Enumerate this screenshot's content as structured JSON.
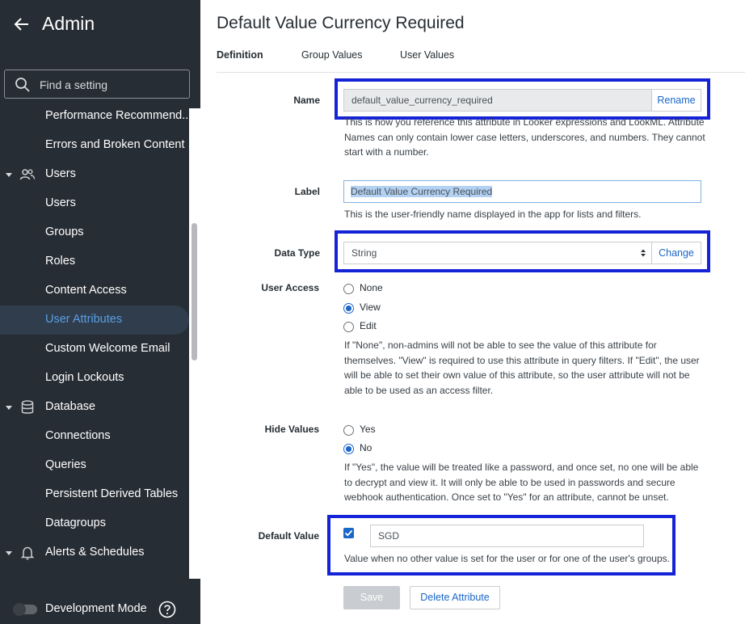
{
  "sidebar": {
    "title": "Admin",
    "back_icon": "arrow-left-icon",
    "search": {
      "placeholder": "Find a setting",
      "value": ""
    },
    "items": [
      {
        "label": "Performance Recommend..."
      },
      {
        "label": "Errors and Broken Content"
      },
      {
        "label": "Users",
        "section": true,
        "icon": "users-icon",
        "expanded": true
      },
      {
        "label": "Users"
      },
      {
        "label": "Groups"
      },
      {
        "label": "Roles"
      },
      {
        "label": "Content Access"
      },
      {
        "label": "User Attributes",
        "active": true
      },
      {
        "label": "Custom Welcome Email"
      },
      {
        "label": "Login Lockouts"
      },
      {
        "label": "Database",
        "section": true,
        "icon": "database-icon",
        "expanded": true
      },
      {
        "label": "Connections"
      },
      {
        "label": "Queries"
      },
      {
        "label": "Persistent Derived Tables"
      },
      {
        "label": "Datagroups"
      },
      {
        "label": "Alerts & Schedules",
        "section": true,
        "icon": "bell-icon",
        "expanded": true
      }
    ],
    "footer": {
      "dev_mode_label": "Development Mode",
      "dev_mode_on": false,
      "help_icon": "help-circle-icon"
    }
  },
  "main": {
    "title": "Default Value Currency Required",
    "tabs": [
      {
        "label": "Definition",
        "active": true
      },
      {
        "label": "Group Values"
      },
      {
        "label": "User Values"
      }
    ],
    "name": {
      "label": "Name",
      "value": "default_value_currency_required",
      "rename_label": "Rename",
      "help": "This is how you reference this attribute in Looker expressions and LookML. Attribute Names can only contain lower case letters, underscores, and numbers. They cannot start with a number."
    },
    "label_field": {
      "label": "Label",
      "value": "Default Value Currency Required",
      "help": "This is the user-friendly name displayed in the app for lists and filters."
    },
    "data_type": {
      "label": "Data Type",
      "value": "String",
      "change_label": "Change"
    },
    "user_access": {
      "label": "User Access",
      "options": [
        {
          "label": "None",
          "selected": false
        },
        {
          "label": "View",
          "selected": true
        },
        {
          "label": "Edit",
          "selected": false
        }
      ],
      "help": "If \"None\", non-admins will not be able to see the value of this attribute for themselves. \"View\" is required to use this attribute in query filters. If \"Edit\", the user will be able to set their own value of this attribute, so the user attribute will not be able to be used as an access filter."
    },
    "hide_values": {
      "label": "Hide Values",
      "options": [
        {
          "label": "Yes",
          "selected": false
        },
        {
          "label": "No",
          "selected": true
        }
      ],
      "help": "If \"Yes\", the value will be treated like a password, and once set, no one will be able to decrypt and view it. It will only be able to be used in passwords and secure webhook authentication. Once set to \"Yes\" for an attribute, cannot be unset."
    },
    "default_value": {
      "label": "Default Value",
      "checked": true,
      "value": "SGD",
      "help": "Value when no other value is set for the user or for one of the user's groups."
    },
    "actions": {
      "save_label": "Save",
      "delete_label": "Delete Attribute"
    },
    "colors": {
      "highlight": "#1523d6",
      "accent": "#1a66c9",
      "sidebar_bg": "#272d34"
    }
  }
}
